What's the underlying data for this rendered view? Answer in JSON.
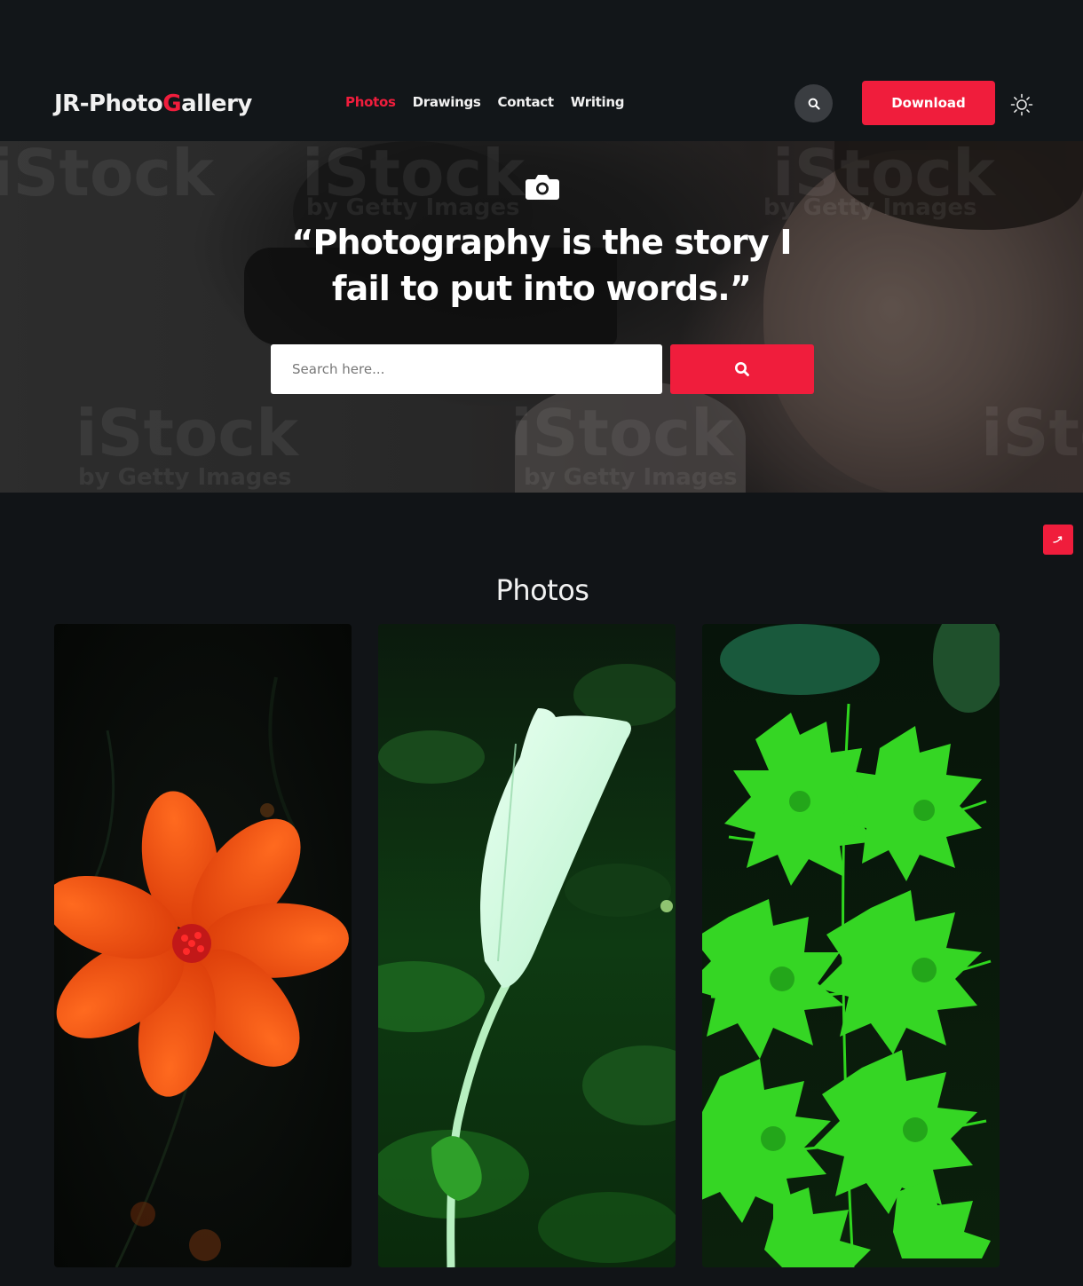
{
  "header": {
    "logo_prefix": "JR-Photo",
    "logo_accent": "G",
    "logo_suffix": "allery",
    "nav": [
      {
        "label": "Photos",
        "active": true
      },
      {
        "label": "Drawings",
        "active": false
      },
      {
        "label": "Contact",
        "active": false
      },
      {
        "label": "Writing",
        "active": false
      }
    ],
    "search_icon": "search-icon",
    "download_label": "Download",
    "theme_icon": "sun-icon"
  },
  "hero": {
    "icon": "camera-icon",
    "quote_line1": "“Photography is the story I",
    "quote_line2": "fail to put into words.”",
    "search_placeholder": "Search here...",
    "search_button_icon": "search-icon",
    "watermark_big": "iStock",
    "watermark_small": "by Getty Images"
  },
  "gallery": {
    "title": "Photos",
    "photos": [
      {
        "subject": "orange cosmos flower on dark background"
      },
      {
        "subject": "white lily bud with green leaves"
      },
      {
        "subject": "green fern leaves"
      }
    ]
  },
  "scroll_top_icon": "arrow-up-icon",
  "colors": {
    "accent": "#f01d3c",
    "background": "#111417",
    "header": "#121619"
  }
}
